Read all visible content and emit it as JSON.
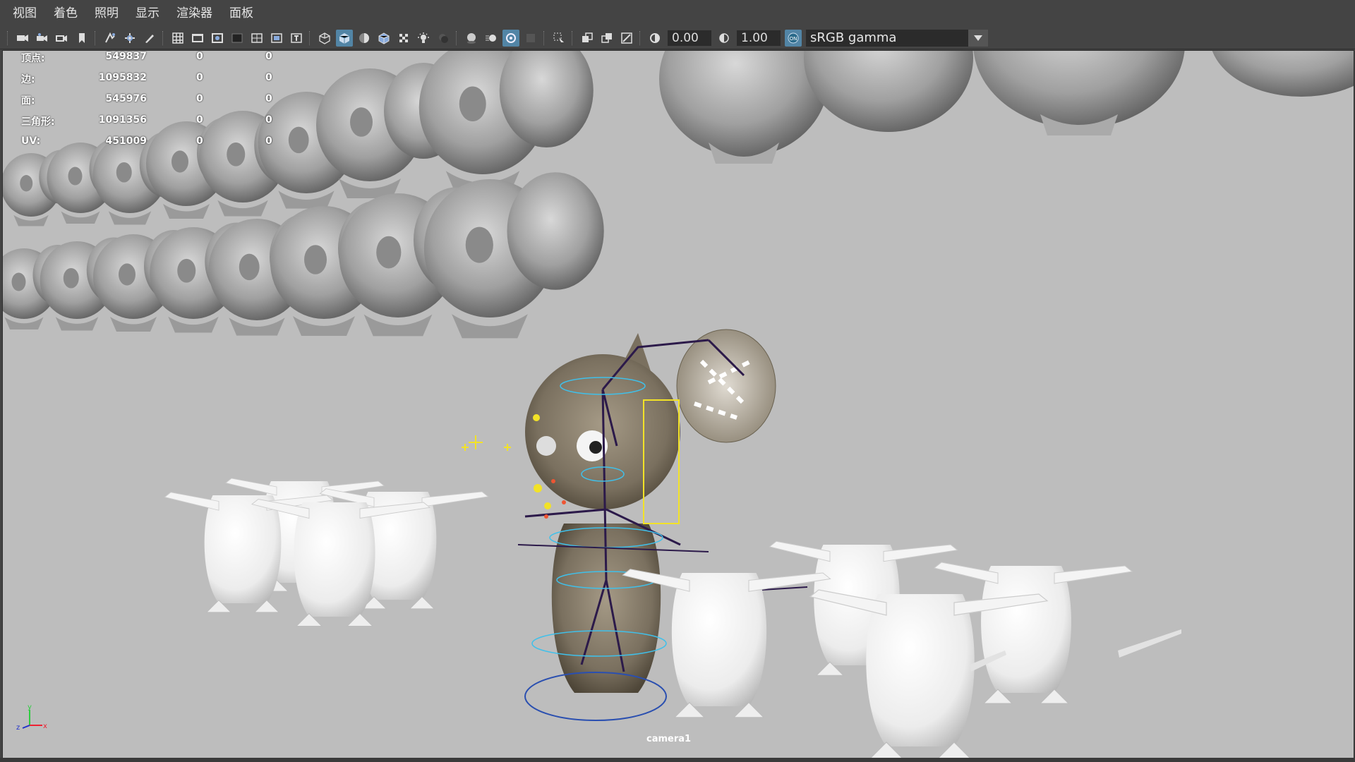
{
  "menubar": {
    "items": [
      "视图",
      "着色",
      "照明",
      "显示",
      "渲染器",
      "面板"
    ]
  },
  "toolbar": {
    "exposure_value": "0.00",
    "gamma_value": "1.00",
    "color_mgmt_badge": "ON",
    "color_space": "sRGB gamma",
    "icons": [
      "camera-icon",
      "camera-attr-icon",
      "bookmark-icon",
      "image-plane-icon",
      "grid-icon",
      "film-gate-icon",
      "resolution-gate-icon",
      "gate-mask-icon",
      "field-chart-icon",
      "safe-action-icon",
      "safe-title-icon",
      "wireframe-icon",
      "smooth-shade-icon",
      "default-material-icon",
      "wireframe-on-shaded-icon",
      "xray-icon",
      "textured-icon",
      "use-all-lights-icon",
      "shadows-icon",
      "ambient-occlusion-icon",
      "motion-blur-icon",
      "anti-aliasing-icon",
      "depth-of-field-icon",
      "isolate-select-icon",
      "xray-joints-icon",
      "xray-active-icon",
      "backface-icon",
      "exposure-icon",
      "gamma-icon",
      "color-management-icon"
    ]
  },
  "hud": {
    "rows": [
      {
        "label": "顶点:",
        "v1": "549837",
        "v2": "0",
        "v3": "0"
      },
      {
        "label": "边:",
        "v1": "1095832",
        "v2": "0",
        "v3": "0"
      },
      {
        "label": "面:",
        "v1": "545976",
        "v2": "0",
        "v3": "0"
      },
      {
        "label": "三角形:",
        "v1": "1091356",
        "v2": "0",
        "v3": "0"
      },
      {
        "label": "UV:",
        "v1": "451009",
        "v2": "0",
        "v3": "0"
      }
    ]
  },
  "viewport": {
    "camera_label": "camera1",
    "axis": {
      "x": "x",
      "y": "y",
      "z": "z"
    },
    "background_color": "#bdbdbd"
  }
}
